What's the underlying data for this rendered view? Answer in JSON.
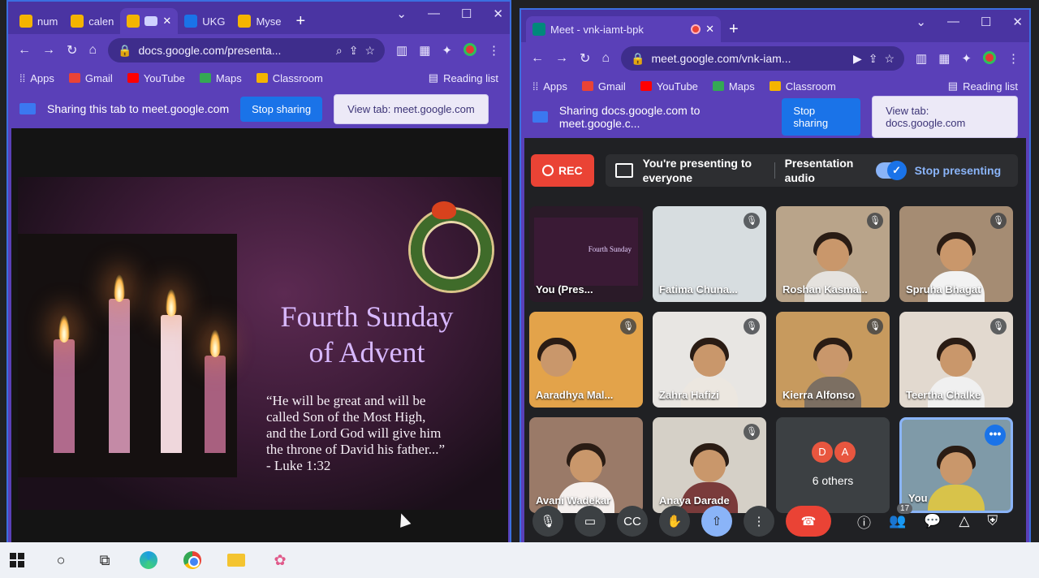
{
  "left_window": {
    "tabs": [
      {
        "label": "num",
        "color": "#f4b400"
      },
      {
        "label": "calen",
        "color": "#f4b400"
      },
      {
        "label": "",
        "color": "#f4b400",
        "active": true
      },
      {
        "label": "UKG",
        "color": "#1a73e8"
      },
      {
        "label": "Myse",
        "color": "#f4b400"
      }
    ],
    "url": "docs.google.com/presenta...",
    "bookmarks": [
      "Apps",
      "Gmail",
      "YouTube",
      "Maps",
      "Classroom"
    ],
    "reading_list": "Reading list",
    "share_text": "Sharing this tab to meet.google.com",
    "stop_sharing": "Stop sharing",
    "view_tab": "View tab: meet.google.com"
  },
  "slide": {
    "title_line1": "Fourth Sunday",
    "title_line2": "of Advent",
    "quote_line1": "“He will be great and will be",
    "quote_line2": "called Son of the Most High,",
    "quote_line3": "and the Lord God will give him",
    "quote_line4": "the throne of David his father...”",
    "quote_ref": "- Luke 1:32"
  },
  "right_window": {
    "tab_title": "Meet - vnk-iamt-bpk",
    "url": "meet.google.com/vnk-iam...",
    "bookmarks": [
      "Apps",
      "Gmail",
      "YouTube",
      "Maps",
      "Classroom"
    ],
    "reading_list": "Reading list",
    "share_text": "Sharing docs.google.com to meet.google.c...",
    "stop_sharing": "Stop sharing",
    "view_tab": "View tab: docs.google.com"
  },
  "meet": {
    "rec_label": "REC",
    "presenting_text": "You're presenting to everyone",
    "presentation_audio": "Presentation audio",
    "stop_presenting": "Stop presenting",
    "participants": [
      {
        "name": "You (Pres...",
        "type": "slide",
        "muted": false
      },
      {
        "name": "Fatima Chuna...",
        "type": "blank",
        "muted": true,
        "bg": "#d7dde0"
      },
      {
        "name": "Roshan Kasma...",
        "type": "person",
        "muted": true,
        "bg": "#b9a48a",
        "shirt": "#e5e2de"
      },
      {
        "name": "Spruha Bhagat",
        "type": "person",
        "muted": true,
        "bg": "#a58c73",
        "shirt": "#f2f2f2"
      },
      {
        "name": "Aaradhya Mal...",
        "type": "person",
        "muted": true,
        "bg": "#e3a34a",
        "shirt": "#c9b28a"
      },
      {
        "name": "Zahra Hafizi",
        "type": "person",
        "muted": true,
        "bg": "#e8e6e3",
        "shirt": "#ece7e0"
      },
      {
        "name": "Kierra Alfonso",
        "type": "person",
        "muted": true,
        "bg": "#c79a5e",
        "shirt": "#7c6f62"
      },
      {
        "name": "Teertha Chalke",
        "type": "person",
        "muted": true,
        "bg": "#e2d9cf",
        "shirt": "#f0f0f0"
      },
      {
        "name": "Avani Wadekar",
        "type": "person",
        "muted": false,
        "bg": "#9a7a68",
        "shirt": "#f5f0ee"
      },
      {
        "name": "Anaya Darade",
        "type": "person",
        "muted": true,
        "bg": "#d5d0c7",
        "shirt": "#7a3b3b"
      },
      {
        "name": "6 others",
        "type": "others",
        "initials": [
          "D",
          "A"
        ]
      },
      {
        "name": "You",
        "type": "self",
        "bg": "#7f9aa8",
        "shirt": "#d8c34a"
      }
    ],
    "people_count": "17"
  },
  "colors": {
    "chrome_purple": "#5a40b8",
    "meet_bg": "#202124",
    "accent_blue": "#8ab4f8",
    "end_red": "#ea4335"
  }
}
